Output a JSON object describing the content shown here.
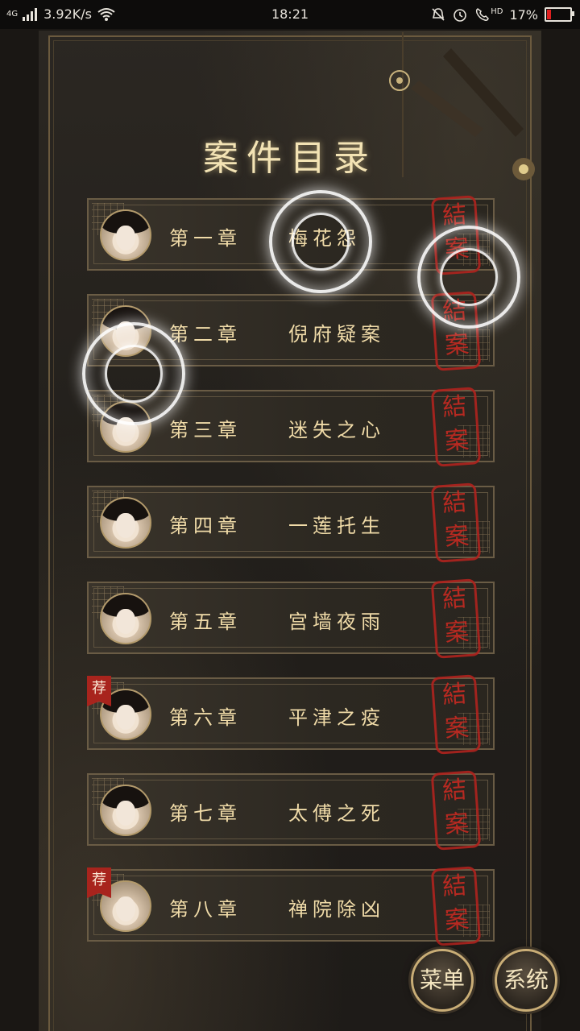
{
  "status_bar": {
    "network": "4G",
    "speed": "3.92K/s",
    "time": "18:21",
    "hd": "HD",
    "battery": "17%",
    "battery_level": 0.17
  },
  "title": "案件目录",
  "seal_text": [
    "結",
    "案"
  ],
  "recommend_badge": "荐",
  "chapters": [
    {
      "num": "第一章",
      "title": "梅花怨",
      "recommended": false
    },
    {
      "num": "第二章",
      "title": "倪府疑案",
      "recommended": false
    },
    {
      "num": "第三章",
      "title": "迷失之心",
      "recommended": false
    },
    {
      "num": "第四章",
      "title": "一莲托生",
      "recommended": false
    },
    {
      "num": "第五章",
      "title": "宫墙夜雨",
      "recommended": false
    },
    {
      "num": "第六章",
      "title": "平津之疫",
      "recommended": true
    },
    {
      "num": "第七章",
      "title": "太傅之死",
      "recommended": false
    },
    {
      "num": "第八章",
      "title": "禅院除凶",
      "recommended": true
    }
  ],
  "buttons": {
    "menu": "菜单",
    "system": "系统"
  }
}
